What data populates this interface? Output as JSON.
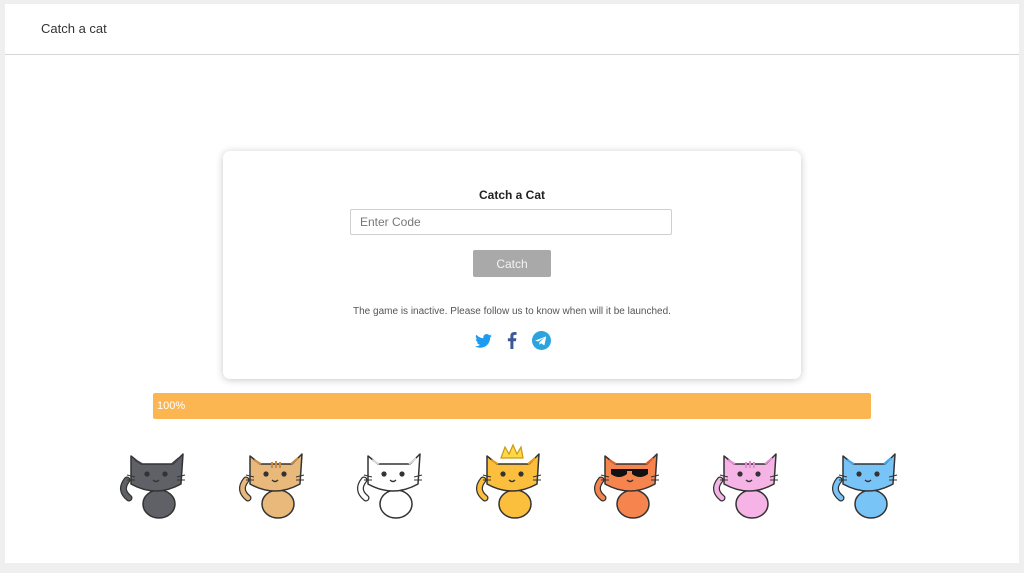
{
  "app": {
    "title": "Catch a cat"
  },
  "card": {
    "title": "Catch a Cat",
    "code_placeholder": "Enter Code",
    "catch_label": "Catch",
    "status": "The game is inactive. Please follow us to know when will it be launched."
  },
  "social": [
    {
      "name": "twitter-icon",
      "color": "#1d9bf0"
    },
    {
      "name": "facebook-icon",
      "color": "#3b5998"
    },
    {
      "name": "telegram-icon",
      "color": "#2aa3df"
    }
  ],
  "progress": {
    "value": 1.0,
    "label": "100%",
    "color": "#fbb652"
  },
  "cats": [
    {
      "name": "gray-cat",
      "color": "#5f6166",
      "dark": "#3e4044",
      "accessory": "none"
    },
    {
      "name": "tabby-cat",
      "color": "#e8b97a",
      "dark": "#c98a45",
      "accessory": "stripes"
    },
    {
      "name": "white-cat",
      "color": "#ffffff",
      "dark": "#d9d9d9",
      "accessory": "none"
    },
    {
      "name": "crowned-cat",
      "color": "#fbbf3d",
      "dark": "#e39b1c",
      "accessory": "crown"
    },
    {
      "name": "sunglasses-cat",
      "color": "#f6844e",
      "dark": "#e05f2b",
      "accessory": "sunglasses"
    },
    {
      "name": "pink-cat",
      "color": "#f5b3e6",
      "dark": "#e48ed2",
      "accessory": "stripes"
    },
    {
      "name": "blue-cat",
      "color": "#79c4f7",
      "dark": "#4aa6e6",
      "accessory": "none"
    }
  ]
}
